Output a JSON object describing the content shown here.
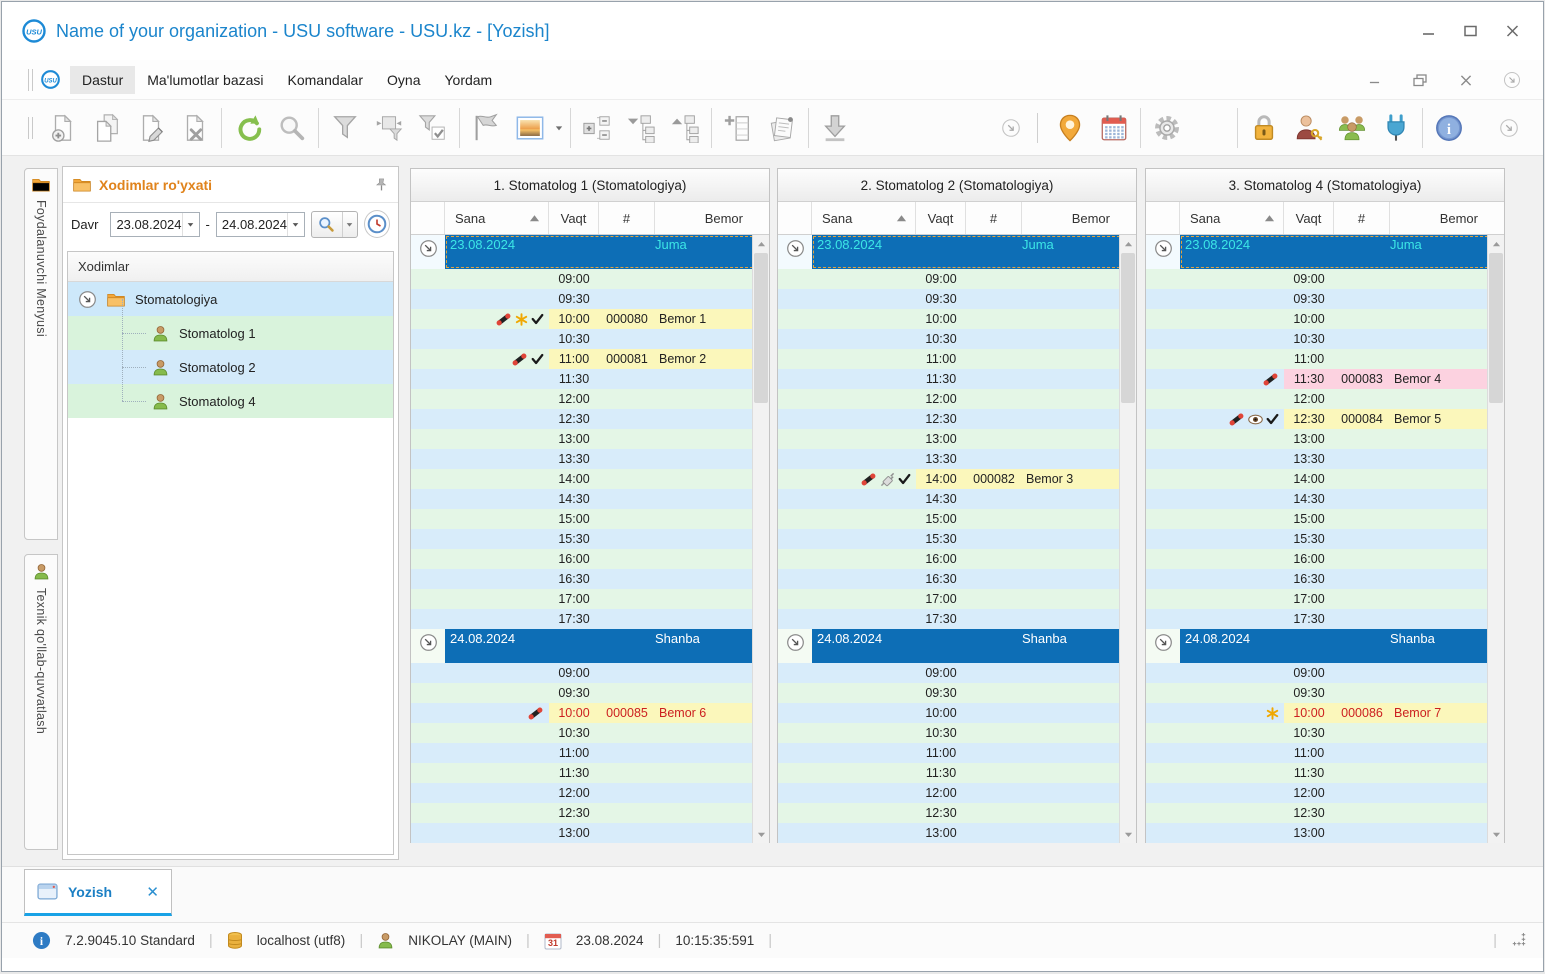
{
  "window": {
    "title": "Name of your organization - USU software - USU.kz - [Yozish]"
  },
  "menu": {
    "items": [
      "Dastur",
      "Ma'lumotlar bazasi",
      "Komandalar",
      "Oyna",
      "Yordam"
    ],
    "active_index": 0
  },
  "toolbar": {
    "layout": [
      "grip",
      "new-document",
      "copy-document",
      "edit-document",
      "delete-document",
      "sep",
      "refresh",
      "search",
      "sep",
      "filter",
      "filter-columns",
      "filter-confirm",
      "sep",
      "flag",
      "image-preview",
      "caret",
      "sep",
      "expand-cells",
      "tree-collapse",
      "tree-expand",
      "sep",
      "add-table",
      "notes",
      "sep",
      "download",
      "flex",
      "chevron-circle",
      "vsep",
      "map-pin",
      "calendar",
      "sep",
      "settings-gear",
      "color-wheel",
      "sep",
      "lock",
      "user-key",
      "users-group",
      "plug",
      "sep",
      "info",
      "gap",
      "chevron-circle"
    ]
  },
  "side_tabs": [
    {
      "icon": "folder-icon",
      "label": "Foydalanuvchi Menyusi"
    },
    {
      "icon": "user-icon",
      "label": "Texnik qo'llab-quvvatlash"
    }
  ],
  "employees_panel": {
    "title": "Xodimlar ro'yxati",
    "period_label": "Davr",
    "date_from": "23.08.2024",
    "range_separator": "-",
    "date_to": "24.08.2024",
    "tree_header": "Xodimlar",
    "group": "Stomatologiya",
    "employees": [
      "Stomatolog 1",
      "Stomatolog 2",
      "Stomatolog 4"
    ]
  },
  "schedule": {
    "grid_headers": [
      "Sana",
      "Vaqt",
      "#",
      "Bemor"
    ],
    "columns": [
      {
        "title": "1. Stomatolog 1 (Stomatologiya)"
      },
      {
        "title": "2. Stomatolog 2 (Stomatologiya)"
      },
      {
        "title": "3. Stomatolog 4 (Stomatologiya)"
      }
    ],
    "days": [
      {
        "date": "23.08.2024",
        "weekday": "Juma",
        "selected": true,
        "times": [
          "09:00",
          "09:30",
          "10:00",
          "10:30",
          "11:00",
          "11:30",
          "12:00",
          "12:30",
          "13:00",
          "13:30",
          "14:00",
          "14:30",
          "15:00",
          "15:30",
          "16:00",
          "16:30",
          "17:00",
          "17:30"
        ]
      },
      {
        "date": "24.08.2024",
        "weekday": "Shanba",
        "selected": false,
        "times": [
          "09:00",
          "09:30",
          "10:00",
          "10:30",
          "11:00",
          "11:30",
          "12:00",
          "12:30",
          "13:00"
        ]
      }
    ],
    "appointments": [
      {
        "column": 0,
        "day": 0,
        "time": "10:00",
        "id": "000080",
        "patient": "Bemor 1",
        "icons": [
          "phone",
          "star",
          "check"
        ],
        "highlight": "yellow",
        "text": "dark"
      },
      {
        "column": 0,
        "day": 0,
        "time": "11:00",
        "id": "000081",
        "patient": "Bemor 2",
        "icons": [
          "phone",
          "check"
        ],
        "highlight": "yellow",
        "text": "dark"
      },
      {
        "column": 1,
        "day": 0,
        "time": "14:00",
        "id": "000082",
        "patient": "Bemor 3",
        "icons": [
          "phone",
          "syringe",
          "check"
        ],
        "highlight": "yellow",
        "text": "dark"
      },
      {
        "column": 2,
        "day": 0,
        "time": "11:30",
        "id": "000083",
        "patient": "Bemor 4",
        "icons": [
          "phone"
        ],
        "highlight": "pink",
        "text": "dark"
      },
      {
        "column": 2,
        "day": 0,
        "time": "12:30",
        "id": "000084",
        "patient": "Bemor 5",
        "icons": [
          "phone",
          "eye",
          "check"
        ],
        "highlight": "yellow",
        "text": "dark"
      },
      {
        "column": 0,
        "day": 1,
        "time": "10:00",
        "id": "000085",
        "patient": "Bemor 6",
        "icons": [
          "phone"
        ],
        "highlight": "yellow",
        "text": "red"
      },
      {
        "column": 2,
        "day": 1,
        "time": "10:00",
        "id": "000086",
        "patient": "Bemor 7",
        "icons": [
          "star"
        ],
        "highlight": "yellow",
        "text": "red"
      }
    ]
  },
  "bottom_tab": {
    "label": "Yozish"
  },
  "status_bar": {
    "version": "7.2.9045.10 Standard",
    "database": "localhost (utf8)",
    "user": "NIKOLAY (MAIN)",
    "date": "23.08.2024",
    "time": "10:15:35:591"
  },
  "colors": {
    "accent_blue": "#1b85cc",
    "date_header_blue": "#0d6eb6",
    "selected_date_text": "#3ce6e6",
    "row_green": "#e4f6e6",
    "row_blue": "#d8ecfa",
    "appointment_yellow": "#fbf7bb",
    "appointment_pink": "#fcd2e0",
    "appointment_red_text": "#cc2020",
    "panel_title_orange": "#e0831c"
  }
}
